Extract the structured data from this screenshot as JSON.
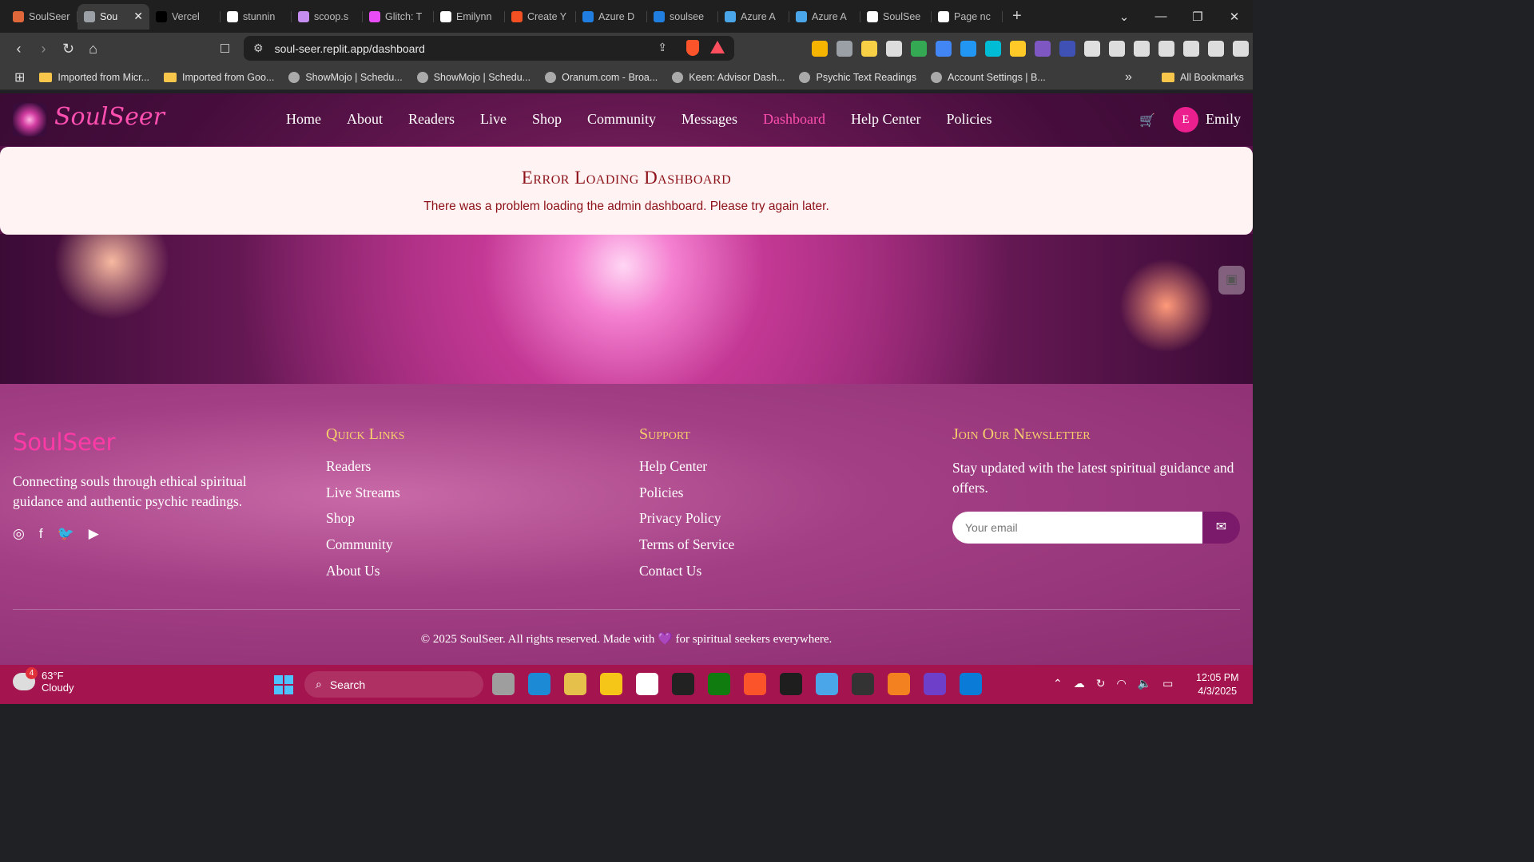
{
  "browser": {
    "tabs": [
      {
        "label": "SoulSeer",
        "color": "#e0673a"
      },
      {
        "label": "Sou",
        "color": "#9aa0a6",
        "active": true
      },
      {
        "label": "Vercel",
        "color": "#000000"
      },
      {
        "label": "stunnin",
        "color": "#ffffff"
      },
      {
        "label": "scoop.s",
        "color": "#c58df0"
      },
      {
        "label": "Glitch: T",
        "color": "#e84cf5"
      },
      {
        "label": "Emilynn",
        "color": "#ffffff"
      },
      {
        "label": "Create Y",
        "color": "#f25022"
      },
      {
        "label": "Azure D",
        "color": "#1f7ee0"
      },
      {
        "label": "soulsee",
        "color": "#1f7ee0"
      },
      {
        "label": "Azure A",
        "color": "#4aa6e8"
      },
      {
        "label": "Azure A",
        "color": "#4aa6e8"
      },
      {
        "label": "SoulSee",
        "color": "#ffffff"
      },
      {
        "label": "Page nc",
        "color": "#ffffff"
      }
    ],
    "close_glyph": "✕",
    "new_tab_glyph": "+",
    "window_controls": {
      "list": "⌄",
      "minimize": "—",
      "restore": "❐",
      "close": "✕"
    },
    "nav": {
      "back": "‹",
      "forward": "›",
      "reload": "↻",
      "home": "⌂",
      "bookmark": "🔖"
    },
    "url": "soul-seer.replit.app/dashboard",
    "bookmarks": [
      {
        "label": "Imported from Micr...",
        "type": "folder"
      },
      {
        "label": "Imported from Goo...",
        "type": "folder"
      },
      {
        "label": "ShowMojo | Schedu...",
        "type": "link"
      },
      {
        "label": "ShowMojo | Schedu...",
        "type": "link"
      },
      {
        "label": "Oranum.com - Broa...",
        "type": "link"
      },
      {
        "label": "Keen: Advisor Dash...",
        "type": "link"
      },
      {
        "label": "Psychic Text Readings",
        "type": "link"
      },
      {
        "label": "Account Settings | B...",
        "type": "link"
      }
    ],
    "bookmarks_more": "»",
    "all_bookmarks": "All Bookmarks",
    "extension_colors": [
      "#f4b400",
      "#9aa0a6",
      "#f7d046",
      "#dddddd",
      "#34a853",
      "#4285f4",
      "#2196f3",
      "#00bcd4",
      "#ffca28",
      "#7e57c2",
      "#3f51b5",
      "#e0e0e0",
      "#dddddd",
      "#dddddd",
      "#dddddd",
      "#dddddd",
      "#dddddd",
      "#dddddd"
    ]
  },
  "site": {
    "logo_text": "SoulSeer",
    "nav": [
      "Home",
      "About",
      "Readers",
      "Live",
      "Shop",
      "Community",
      "Messages",
      "Dashboard",
      "Help Center",
      "Policies"
    ],
    "active_nav": "Dashboard",
    "cart_icon": "🛒",
    "avatar_initial": "E",
    "username": "Emily"
  },
  "error": {
    "title": "Error Loading Dashboard",
    "message": "There was a problem loading the admin dashboard. Please try again later."
  },
  "footer": {
    "brand": "SoulSeer",
    "tagline": "Connecting souls through ethical spiritual guidance and authentic psychic readings.",
    "socials": [
      "instagram-icon",
      "facebook-icon",
      "twitter-icon",
      "youtube-icon"
    ],
    "quick_links": {
      "title": "Quick Links",
      "items": [
        "Readers",
        "Live Streams",
        "Shop",
        "Community",
        "About Us"
      ]
    },
    "support": {
      "title": "Support",
      "items": [
        "Help Center",
        "Policies",
        "Privacy Policy",
        "Terms of Service",
        "Contact Us"
      ]
    },
    "newsletter": {
      "title": "Join Our Newsletter",
      "description": "Stay updated with the latest spiritual guidance and offers.",
      "placeholder": "Your email"
    },
    "copyright_pre": "© 2025 SoulSeer. All rights reserved. Made with",
    "copyright_post": "for spiritual seekers everywhere."
  },
  "taskbar": {
    "weather_badge": "4",
    "temperature": "63°F",
    "condition": "Cloudy",
    "search_label": "Search",
    "time": "12:05 PM",
    "date": "4/3/2025",
    "app_colors": [
      "#9e9e9e",
      "#1d8ad6",
      "#e5c04b",
      "#f5c518",
      "#ffffff",
      "#222222",
      "#107c10",
      "#fb542b",
      "#1e1e1e",
      "#4aa6e8",
      "#333333",
      "#f48120",
      "#6e40c9",
      "#0a7bd6"
    ]
  },
  "colors": {
    "accent": "#ff4fb0",
    "error_text": "#8c1118",
    "footer_heading": "#f6cf6b",
    "taskbar": "#a4154f"
  }
}
